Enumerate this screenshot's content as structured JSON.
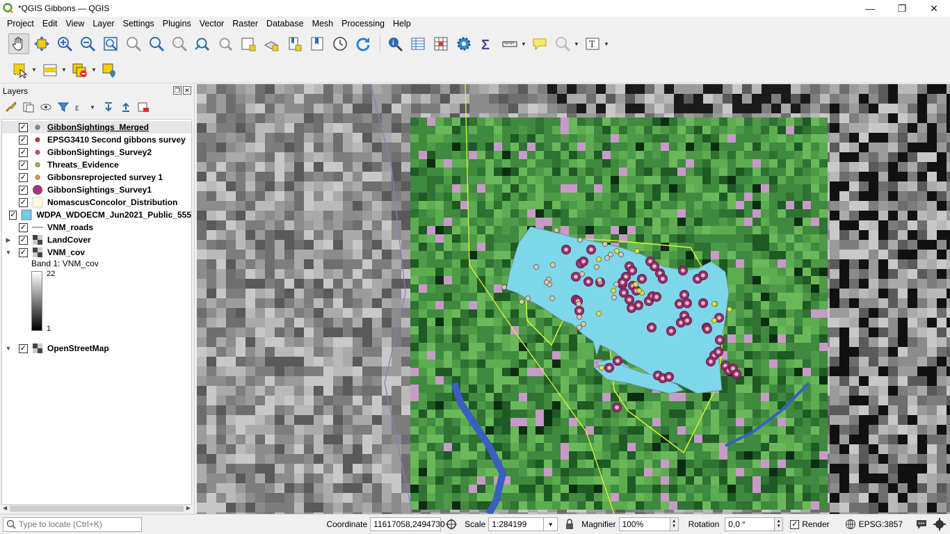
{
  "window": {
    "title": "*QGIS Gibbons — QGIS",
    "minimize": "—",
    "maximize": "❐",
    "close": "✕"
  },
  "menu": [
    "Project",
    "Edit",
    "View",
    "Layer",
    "Settings",
    "Plugins",
    "Vector",
    "Raster",
    "Database",
    "Mesh",
    "Processing",
    "Help"
  ],
  "layers_panel": {
    "title": "Layers",
    "float_btn": "❐",
    "close_btn": "✕",
    "layers": [
      {
        "name": "GibbonSightings_Merged",
        "checked": true,
        "symbol": "point",
        "color": "#7a8fa0",
        "expand": ""
      },
      {
        "name": "EPSG3410 Second gibbons survey",
        "checked": true,
        "symbol": "point",
        "color": "#c0392b",
        "expand": ""
      },
      {
        "name": "GibbonSightings_Survey2",
        "checked": true,
        "symbol": "point",
        "color": "#d04a8a",
        "expand": ""
      },
      {
        "name": "Threats_Evidence",
        "checked": true,
        "symbol": "point",
        "color": "#8fbf3a",
        "expand": ""
      },
      {
        "name": "Gibbonsreprojected survey 1",
        "checked": true,
        "symbol": "point",
        "color": "#e0a040",
        "expand": ""
      },
      {
        "name": "GibbonSightings_Survey1",
        "checked": true,
        "symbol": "bigpoint",
        "color": "#b03080",
        "expand": ""
      },
      {
        "name": "NomascusConcolor_Distribution",
        "checked": true,
        "symbol": "poly-empty",
        "color": "#fffbe0",
        "expand": ""
      },
      {
        "name": "WDPA_WDOECM_Jun2021_Public_555",
        "checked": true,
        "symbol": "poly",
        "color": "#6fd0e8",
        "expand": ""
      },
      {
        "name": "VNM_roads",
        "checked": true,
        "symbol": "line",
        "color": "#a8a8c8",
        "expand": ""
      },
      {
        "name": "LandCover",
        "checked": true,
        "symbol": "raster",
        "color": "#333333",
        "expand": "▶"
      },
      {
        "name": "VNM_cov",
        "checked": true,
        "symbol": "raster",
        "color": "#333333",
        "expand": "▼"
      }
    ],
    "band_label": "Band 1: VNM_cov",
    "ramp_max": "22",
    "ramp_min": "1",
    "basemap": {
      "name": "OpenStreetMap",
      "checked": true,
      "expand": "▼"
    }
  },
  "status": {
    "locate_placeholder": "Type to locate (Ctrl+K)",
    "coordinate_label": "Coordinate",
    "coordinate_value": "11617058,2494730",
    "scale_label": "Scale",
    "scale_value": "1:284199",
    "magnifier_label": "Magnifier",
    "magnifier_value": "100%",
    "rotation_label": "Rotation",
    "rotation_value": "0,0 °",
    "render_label": "Render",
    "crs": "EPSG:3857"
  },
  "colors": {
    "protected_area": "#7dd6ea",
    "distribution_outline": "#d7f03a",
    "survey1_fill": "#9b2e72",
    "survey_point": "#d9c8b0",
    "threat_point": "#d8e04a",
    "landcover_dark": "#1f5a24",
    "landcover_mid": "#3f8a3f",
    "landcover_light": "#6ab85a",
    "urban": "#c89ac8"
  }
}
